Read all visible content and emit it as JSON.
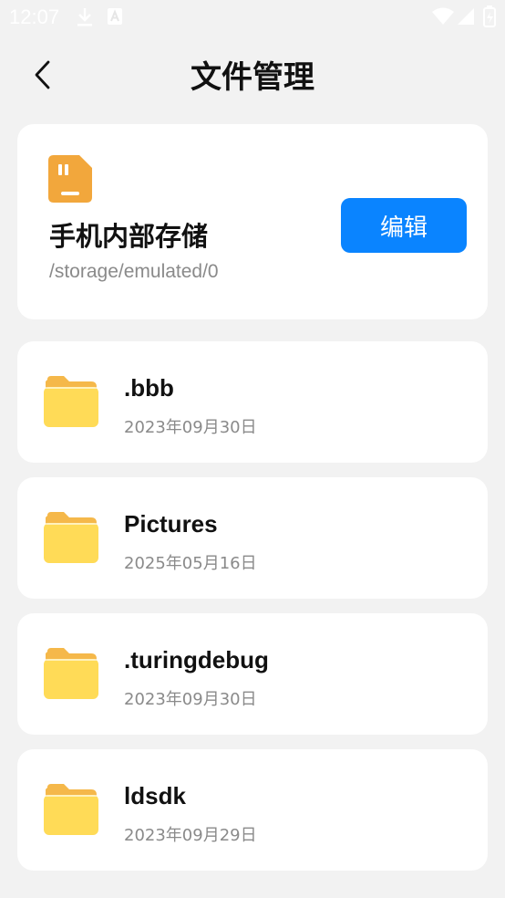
{
  "status_bar": {
    "time": "12:07",
    "icons": [
      "download-icon",
      "font-app-icon",
      "wifi-icon",
      "signal-icon",
      "battery-icon"
    ]
  },
  "header": {
    "back_icon": "chevron-left-icon",
    "title": "文件管理"
  },
  "storage": {
    "icon": "storage-device-icon",
    "name": "手机内部存储",
    "path": "/storage/emulated/0",
    "edit_label": "编辑"
  },
  "folders": [
    {
      "name": ".bbb",
      "date": "2023年09月30日"
    },
    {
      "name": "Pictures",
      "date": "2025年05月16日"
    },
    {
      "name": ".turingdebug",
      "date": "2023年09月30日"
    },
    {
      "name": "ldsdk",
      "date": "2023年09月29日"
    }
  ],
  "colors": {
    "accent": "#0a84ff",
    "folder_front": "#ffdb57",
    "folder_back": "#f5b84a",
    "background": "#f2f2f2",
    "card": "#ffffff",
    "secondary_text": "#8a8a8a"
  }
}
